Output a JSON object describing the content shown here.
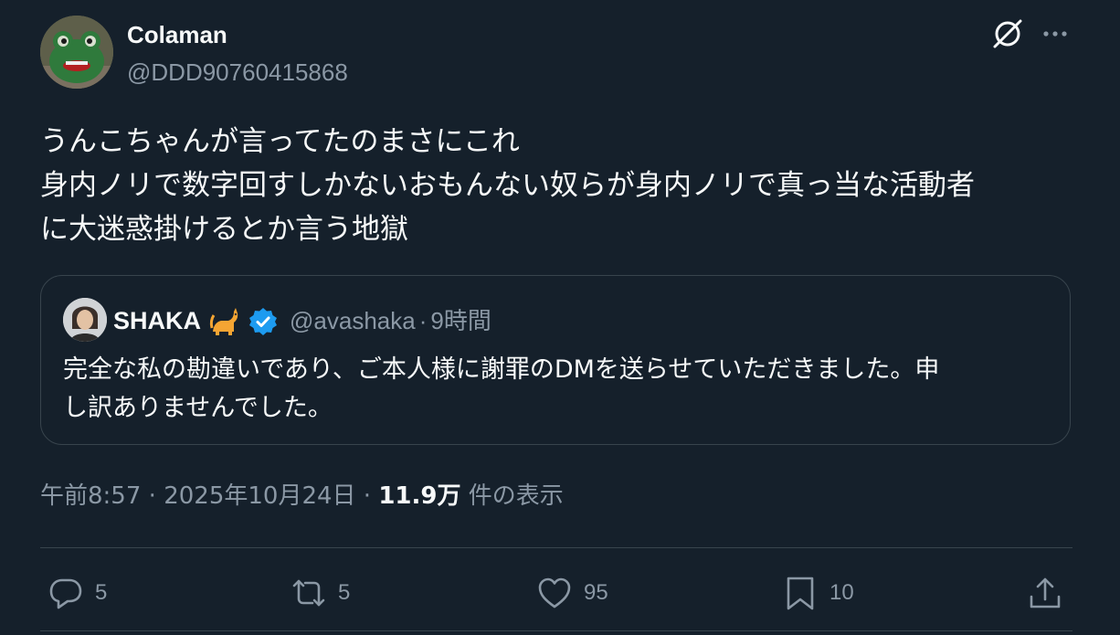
{
  "author": {
    "display_name": "Colaman",
    "handle": "@DDD90760415868"
  },
  "tweet": {
    "lines": [
      "うんこちゃんが言ってたのまさにこれ",
      "身内ノリで数字回すしかないおもんない奴らが身内ノリで真っ当な活動者",
      "に大迷惑掛けるとか言う地獄"
    ]
  },
  "quote": {
    "display_name": "SHAKA",
    "emoji": "🐈",
    "handle": "@avashaka",
    "separator": "·",
    "time": "9時間",
    "lines": [
      "完全な私の勘違いであり、ご本人様に謝罪のDMを送らせていただきました。申",
      "し訳ありませんでした。"
    ]
  },
  "meta": {
    "time": "午前8:57",
    "separator": "·",
    "date": "2025年10月24日",
    "views_count": "11.9万",
    "views_label": "件の表示"
  },
  "actions": {
    "replies": "5",
    "retweets": "5",
    "likes": "95",
    "bookmarks": "10"
  },
  "icons": {
    "grok": "grok-icon",
    "more": "more-icon",
    "reply": "reply-icon",
    "retweet": "retweet-icon",
    "like": "heart-icon",
    "bookmark": "bookmark-icon",
    "share": "share-icon",
    "verified": "verified-badge-icon"
  },
  "colors": {
    "background": "#15202b",
    "text": "#f7f9f9",
    "secondary_text": "#8b98a5",
    "border": "#38444d",
    "verified": "#1d9bf0"
  }
}
